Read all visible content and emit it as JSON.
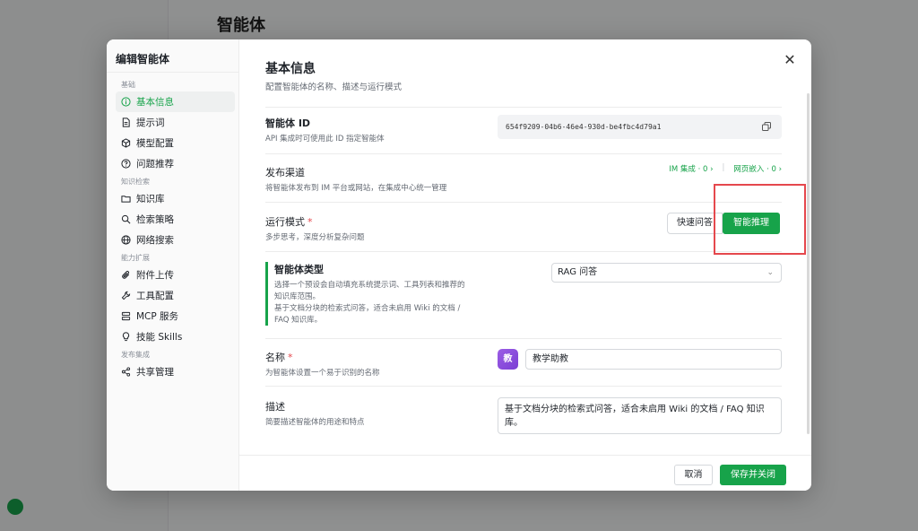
{
  "colors": {
    "accent": "#17a34a",
    "required": "#e5484d",
    "highlight": "#e5484d"
  },
  "background_app": {
    "page_title": "智能体"
  },
  "dialog": {
    "title": "编辑智能体",
    "close_icon": "close-icon",
    "sidebar": {
      "sections": [
        {
          "title": "基础",
          "items": [
            {
              "label": "基本信息",
              "icon": "info-icon",
              "active": true
            },
            {
              "label": "提示词",
              "icon": "document-icon"
            },
            {
              "label": "模型配置",
              "icon": "cube-icon"
            },
            {
              "label": "问题推荐",
              "icon": "question-icon"
            }
          ]
        },
        {
          "title": "知识检索",
          "items": [
            {
              "label": "知识库",
              "icon": "folder-icon"
            },
            {
              "label": "检索策略",
              "icon": "search-icon"
            },
            {
              "label": "网络搜索",
              "icon": "globe-icon"
            }
          ]
        },
        {
          "title": "能力扩展",
          "items": [
            {
              "label": "附件上传",
              "icon": "paperclip-icon"
            },
            {
              "label": "工具配置",
              "icon": "tool-icon"
            },
            {
              "label": "MCP 服务",
              "icon": "server-icon"
            },
            {
              "label": "技能 Skills",
              "icon": "lightbulb-icon"
            }
          ]
        },
        {
          "title": "发布集成",
          "items": [
            {
              "label": "共享管理",
              "icon": "share-icon"
            }
          ]
        }
      ]
    },
    "main": {
      "title": "基本信息",
      "subtitle": "配置智能体的名称、描述与运行模式",
      "agent_id": {
        "label": "智能体 ID",
        "desc": "API 集成时可使用此 ID 指定智能体",
        "value": "654f9209-04b6-46e4-930d-be4fbc4d79a1"
      },
      "channels": {
        "label": "发布渠道",
        "desc": "将智能体发布到 IM 平台或网站，在集成中心统一管理",
        "im_link": "IM 集成 · 0 ›",
        "web_link": "网页嵌入 · 0 ›"
      },
      "run_mode": {
        "label": "运行模式",
        "required_mark": "*",
        "desc": "多步思考，深度分析复杂问题",
        "options": [
          "快速问答",
          "智能推理"
        ],
        "selected": "智能推理"
      },
      "agent_type": {
        "label": "智能体类型",
        "desc_lines": [
          "选择一个预设会自动填充系统提示词、工具列表和推荐的",
          "知识库范围。",
          "基于文档分块的检索式问答，适合未启用 Wiki 的文档 /",
          "FAQ 知识库。"
        ],
        "selected": "RAG 问答"
      },
      "name": {
        "label": "名称",
        "required_mark": "*",
        "desc": "为智能体设置一个易于识别的名称",
        "avatar_char": "教",
        "value": "教学助教"
      },
      "description": {
        "label": "描述",
        "desc": "简要描述智能体的用途和特点",
        "value": "基于文档分块的检索式问答，适合未启用 Wiki 的文档 / FAQ 知识库。"
      }
    },
    "footer": {
      "cancel": "取消",
      "save": "保存并关闭"
    }
  }
}
